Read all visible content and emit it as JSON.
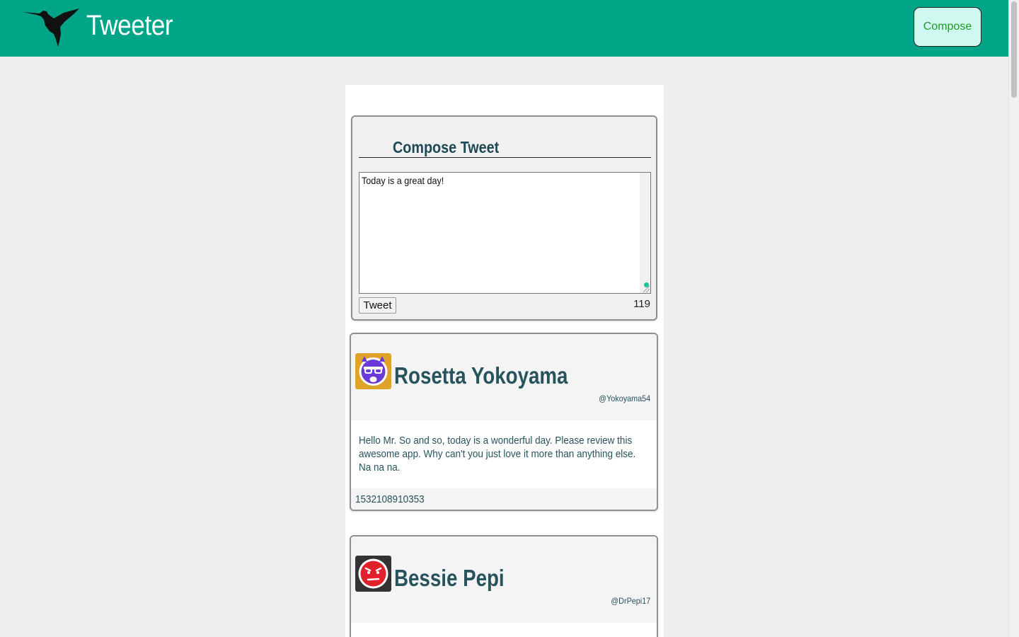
{
  "app": {
    "brand": "Tweeter",
    "compose_button": "Compose",
    "accent_color": "#00a587"
  },
  "compose": {
    "title": "Compose Tweet",
    "text": "Today is a great day!",
    "submit_label": "Tweet",
    "counter": "119"
  },
  "tweets": [
    {
      "name": "Rosetta Yokoyama",
      "handle": "@Yokoyama54",
      "avatar_icon": "cool-sunglasses-face-icon",
      "avatar_bg": "#e0a32a",
      "content": "Hello Mr. So and so, today is a wonderful day. Please review this awesome app. Why can't you just love it more than anything else. Na na na.",
      "timestamp": "1532108910353"
    },
    {
      "name": "Bessie Pepi",
      "handle": "@DrPepi17",
      "avatar_icon": "worried-face-icon",
      "avatar_bg": "#333333"
    }
  ]
}
